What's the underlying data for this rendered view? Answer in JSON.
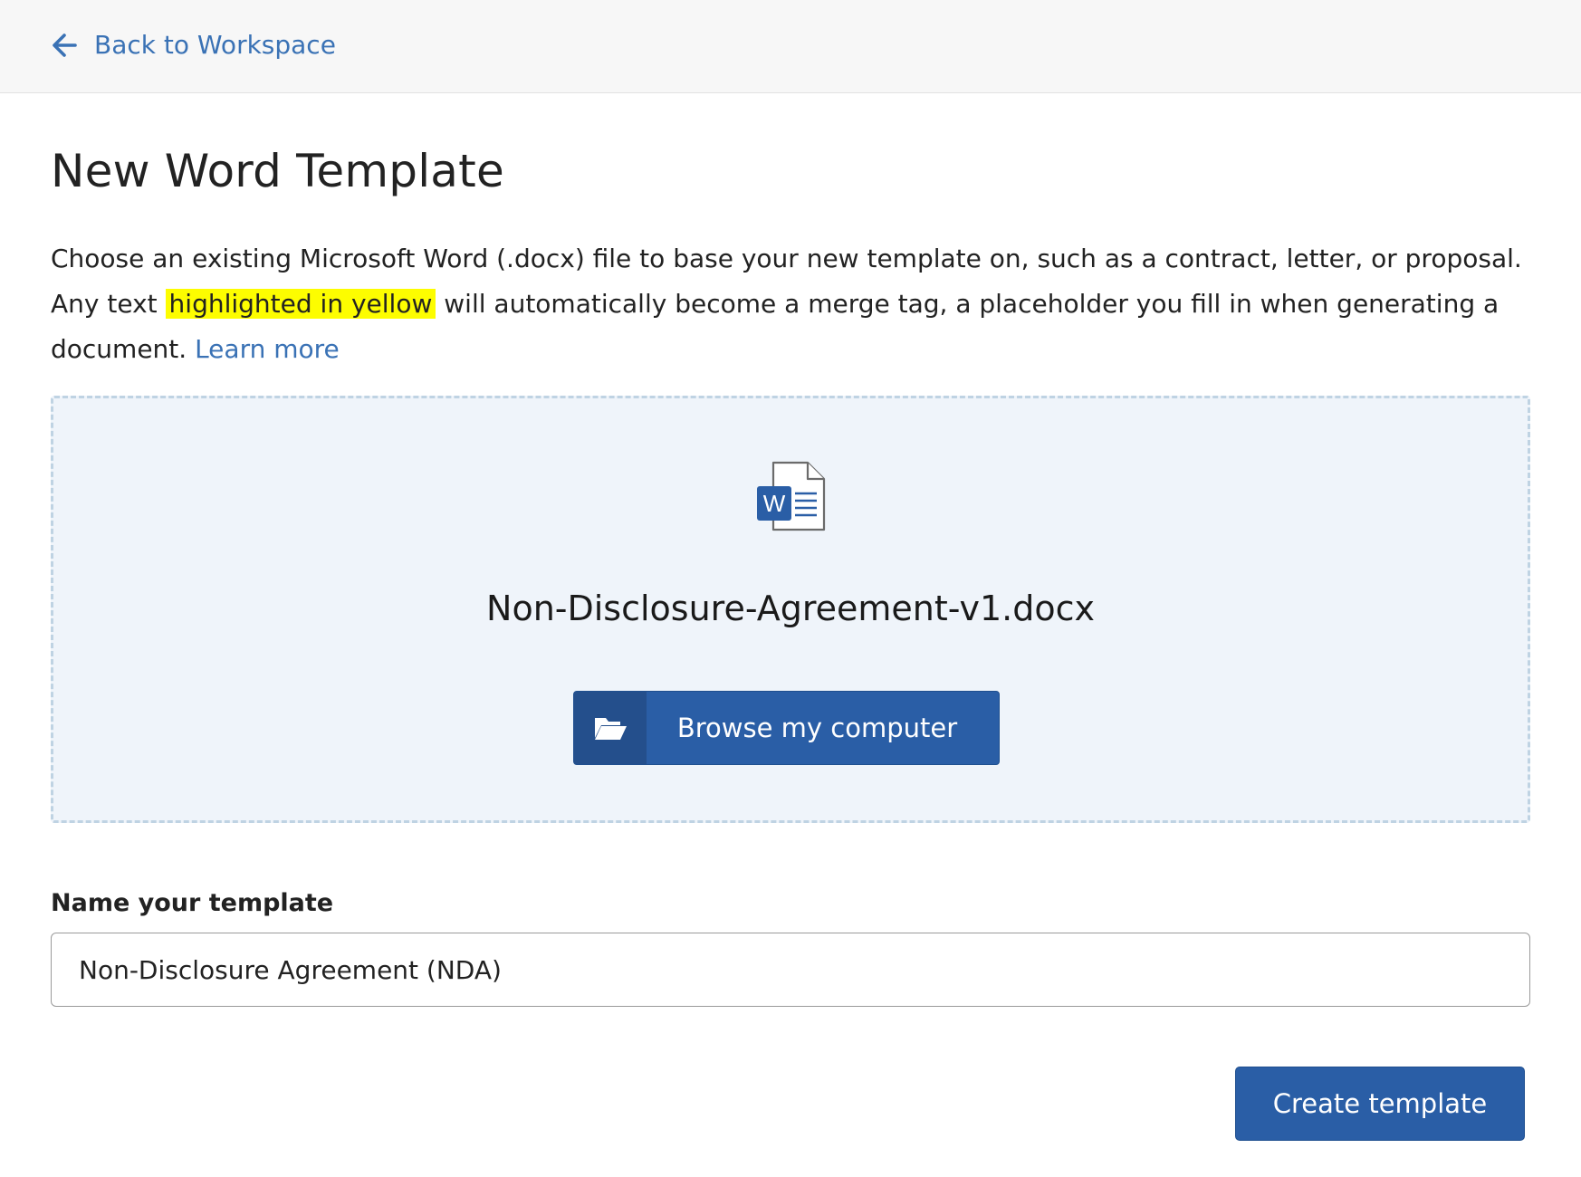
{
  "nav": {
    "back_label": "Back to Workspace"
  },
  "page": {
    "title": "New Word Template",
    "intro_part1": "Choose an existing Microsoft Word (.docx) file to base your new template on, such as a contract, letter, or proposal. Any text ",
    "intro_highlight": "highlighted in yellow",
    "intro_part2": " will automatically become a merge tag, a placeholder you fill in when generating a document. ",
    "learn_more": "Learn more"
  },
  "upload": {
    "file_icon": "word-document-icon",
    "file_icon_letter": "W",
    "file_name": "Non-Disclosure-Agreement-v1.docx",
    "browse_icon": "folder-open-icon",
    "browse_label": "Browse my computer"
  },
  "form": {
    "name_label": "Name your template",
    "name_value": "Non-Disclosure Agreement (NDA)"
  },
  "actions": {
    "create_label": "Create template"
  },
  "colors": {
    "link": "#3a72b5",
    "primary": "#2a5ea6",
    "highlight": "#fdfd00",
    "dropzone_bg": "#eff4fa"
  }
}
